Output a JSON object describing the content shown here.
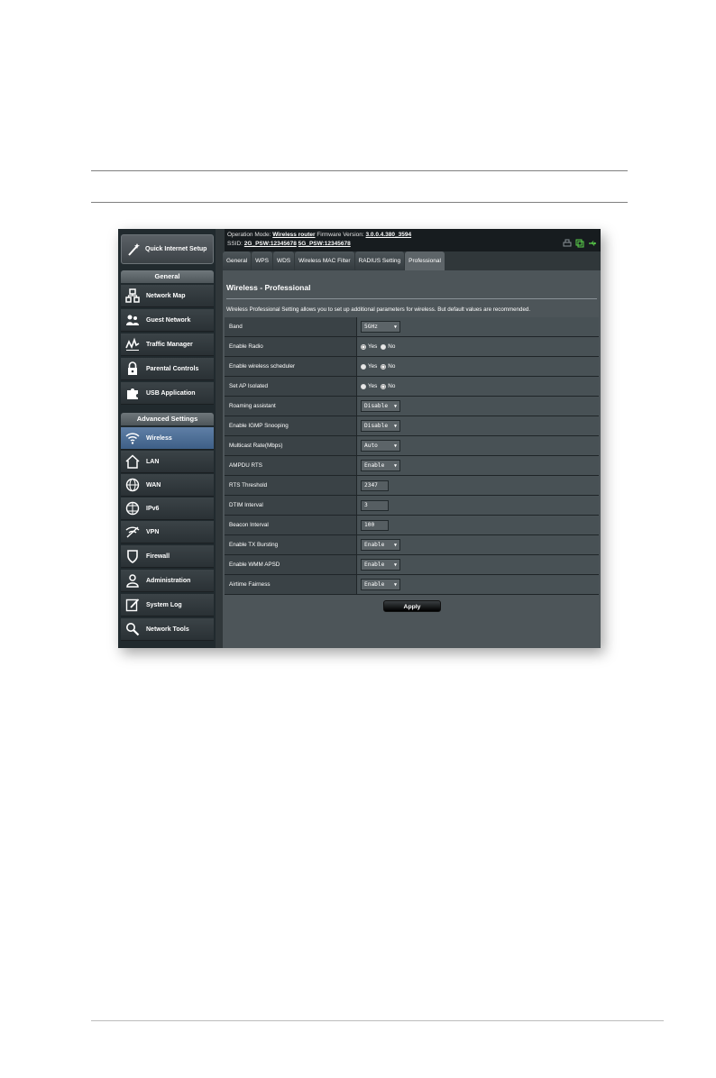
{
  "router": {
    "quick_setup": "Quick Internet Setup",
    "general_header": "General",
    "general_items": [
      "Network Map",
      "Guest Network",
      "Traffic Manager",
      "Parental Controls",
      "USB Application"
    ],
    "advanced_header": "Advanced Settings",
    "advanced_items": [
      "Wireless",
      "LAN",
      "WAN",
      "IPv6",
      "VPN",
      "Firewall",
      "Administration",
      "System Log",
      "Network Tools"
    ],
    "active_item": "Wireless",
    "top": {
      "op_mode_label": "Operation Mode:",
      "op_mode_value": "Wireless router",
      "fw_label": "Firmware Version:",
      "fw_value": "3.0.0.4.380_3594",
      "ssid_label": "SSID:",
      "ssid_2g": "2G_PSW:12345678",
      "ssid_5g": "5G_PSW:12345678"
    },
    "tabs": [
      "General",
      "WPS",
      "WDS",
      "Wireless MAC Filter",
      "RADIUS Setting",
      "Professional"
    ],
    "active_tab": "Professional",
    "page_title": "Wireless - Professional",
    "description": "Wireless Professional Setting allows you to set up additional parameters for wireless. But default values are recommended.",
    "settings": [
      {
        "label": "Band",
        "type": "select",
        "value": "5GHz"
      },
      {
        "label": "Enable Radio",
        "type": "radio",
        "yes": "Yes",
        "no": "No",
        "selected": "Yes"
      },
      {
        "label": "Enable wireless scheduler",
        "type": "radio",
        "yes": "Yes",
        "no": "No",
        "selected": "No"
      },
      {
        "label": "Set AP Isolated",
        "type": "radio",
        "yes": "Yes",
        "no": "No",
        "selected": "No"
      },
      {
        "label": "Roaming assistant",
        "type": "select",
        "value": "Disable"
      },
      {
        "label": "Enable IGMP Snooping",
        "type": "select",
        "value": "Disable"
      },
      {
        "label": "Multicast Rate(Mbps)",
        "type": "select",
        "value": "Auto"
      },
      {
        "label": "AMPDU RTS",
        "type": "select",
        "value": "Enable"
      },
      {
        "label": "RTS Threshold",
        "type": "input",
        "value": "2347"
      },
      {
        "label": "DTIM Interval",
        "type": "input",
        "value": "3"
      },
      {
        "label": "Beacon Interval",
        "type": "input",
        "value": "100"
      },
      {
        "label": "Enable TX Bursting",
        "type": "select",
        "value": "Enable"
      },
      {
        "label": "Enable WMM APSD",
        "type": "select",
        "value": "Enable"
      },
      {
        "label": "Airtime Fairness",
        "type": "select",
        "value": "Enable"
      }
    ],
    "apply_label": "Apply",
    "colors": {
      "active_nav": "#4e6f98",
      "panel": "#4d5559",
      "sidebar": "#212a2e",
      "status_green": "#5bd24b"
    }
  }
}
